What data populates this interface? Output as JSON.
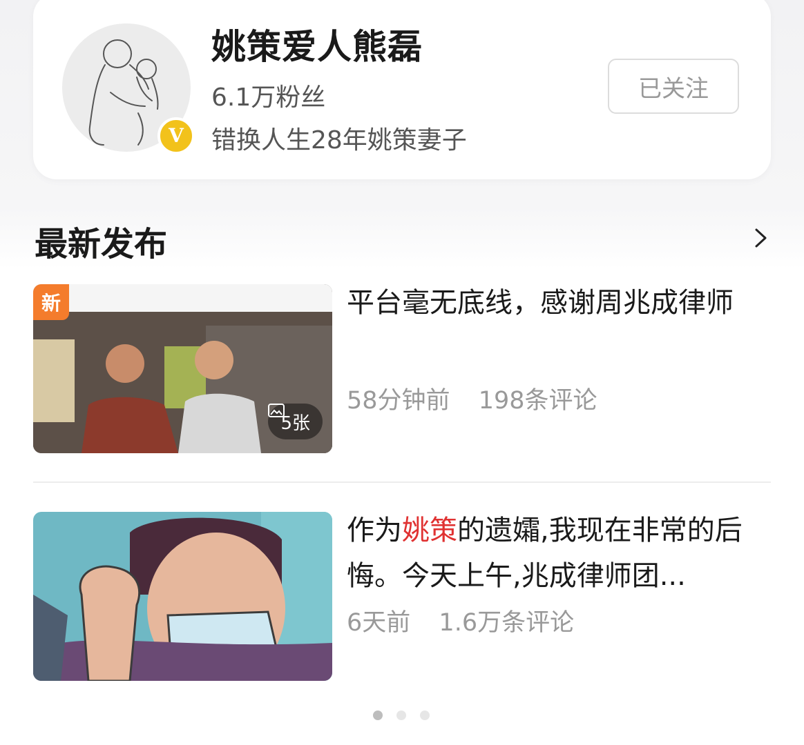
{
  "profile": {
    "name": "姚策爱人熊磊",
    "followers": "6.1万粉丝",
    "description": "错换人生28年姚策妻子",
    "verified_badge": "V",
    "follow_label": "已关注"
  },
  "section": {
    "title": "最新发布"
  },
  "posts": [
    {
      "new_tag": "新",
      "title": "平台毫无底线，感谢周兆成律师",
      "time": "58分钟前",
      "comments": "198条评论",
      "photo_count": "5张"
    },
    {
      "title_prefix": "作为",
      "title_highlight": "姚策",
      "title_suffix": "的遗孀,我现在非常的后悔。今天上午,兆成律师团...",
      "time": "6天前",
      "comments": "1.6万条评论"
    }
  ],
  "colors": {
    "new_tag": "#f47c2c",
    "highlight": "#e03232",
    "verified": "#f2c21b"
  },
  "pagination": {
    "active": 1,
    "total": 3
  }
}
